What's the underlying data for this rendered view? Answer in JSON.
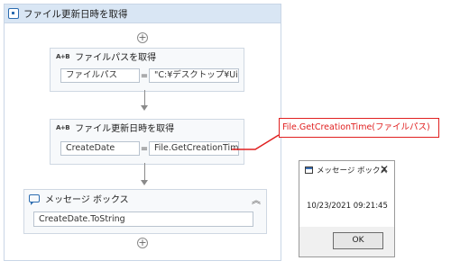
{
  "sequence": {
    "title": "ファイル更新日時を取得"
  },
  "activity1": {
    "icon": "A+B",
    "title": "ファイルパスを取得",
    "left_value": "ファイルパス",
    "equals": "=",
    "right_value": "\"C:¥デスクトップ¥UiP..."
  },
  "activity2": {
    "icon": "A+B",
    "title": "ファイル更新日時を取得",
    "left_value": "CreateDate",
    "equals": "=",
    "right_value": "File.GetCreationTim"
  },
  "message_box": {
    "title": "メッセージ ボックス",
    "expression": "CreateDate.ToString",
    "collapse_glyph": "︽"
  },
  "callout": {
    "text": "File.GetCreationTime(ファイルパス)",
    "color": "#e02020"
  },
  "dialog": {
    "title": "メッセージ ボックス",
    "close_glyph": "✕",
    "message": "10/23/2021 09:21:45",
    "ok_label": "OK"
  },
  "add_glyph": "+",
  "colors": {
    "header_bg": "#d9e6f4",
    "accent": "#2c6cb0",
    "annotation": "#e02020"
  }
}
